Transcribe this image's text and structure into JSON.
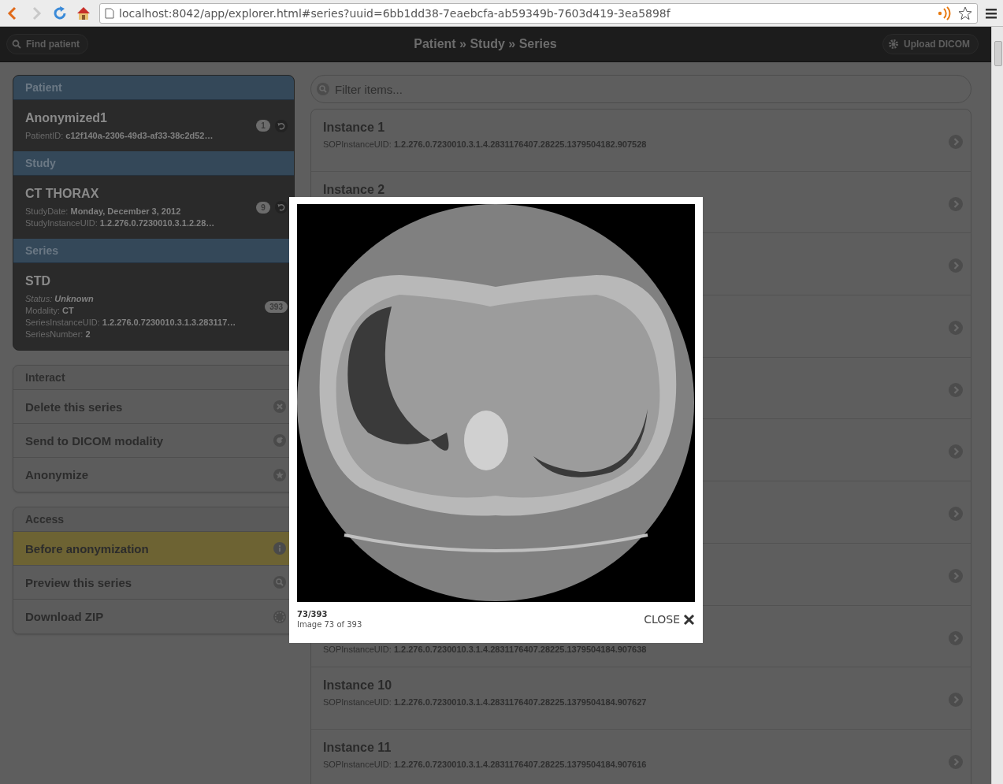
{
  "browser": {
    "url": "localhost:8042/app/explorer.html#series?uuid=6bb1dd38-7eaebcfa-ab59349b-7603d419-3ea5898f"
  },
  "header": {
    "find_button": "Find patient",
    "breadcrumb": "Patient » Study » Series",
    "upload_button": "Upload DICOM"
  },
  "sections": [
    {
      "heading": "Patient",
      "name": "Anonymized1",
      "count": "1",
      "refresh": true,
      "fields": [
        {
          "text": "PatientID: **c12f140a-2306-49d3-af33-38c2d52…**",
          "italic": false
        }
      ]
    },
    {
      "heading": "Study",
      "name": "CT THORAX",
      "count": "9",
      "refresh": true,
      "fields": [
        {
          "text": "StudyDate: **Monday, December 3, 2012**",
          "italic": false
        },
        {
          "text": "StudyInstanceUID: **1.2.276.0.7230010.3.1.2.28…**",
          "italic": false
        }
      ]
    },
    {
      "heading": "Series",
      "name": "STD",
      "count": "393",
      "refresh": false,
      "fields": [
        {
          "text": "Status: **Unknown**",
          "italic": true
        },
        {
          "text": "Modality: **CT**",
          "italic": false
        },
        {
          "text": "SeriesInstanceUID: **1.2.276.0.7230010.3.1.3.283117…**",
          "italic": false
        },
        {
          "text": "SeriesNumber: **2**",
          "italic": false
        }
      ]
    }
  ],
  "interact": {
    "heading": "Interact",
    "items": [
      {
        "label": "Delete this series",
        "kind": "delete",
        "selected": false
      },
      {
        "label": "Send to DICOM modality",
        "kind": "send",
        "selected": false
      },
      {
        "label": "Anonymize",
        "kind": "star",
        "selected": false
      }
    ]
  },
  "access": {
    "heading": "Access",
    "items": [
      {
        "label": "Before anonymization",
        "kind": "info",
        "selected": true
      },
      {
        "label": "Preview this series",
        "kind": "search",
        "selected": false
      },
      {
        "label": "Download ZIP",
        "kind": "download",
        "selected": false
      }
    ]
  },
  "filter": {
    "placeholder": "Filter items..."
  },
  "instances": [
    {
      "kind": "full",
      "title": "Instance 1",
      "uid": "SOPInstanceUID: **1.2.276.0.7230010.3.1.4.2831176407.28225.1379504182.907528**"
    },
    {
      "kind": "title",
      "title": "Instance 2"
    },
    {
      "kind": "covered"
    },
    {
      "kind": "covered"
    },
    {
      "kind": "covered"
    },
    {
      "kind": "covered"
    },
    {
      "kind": "covered"
    },
    {
      "kind": "covered"
    },
    {
      "kind": "uid",
      "uid": "SOPInstanceUID: **1.2.276.0.7230010.3.1.4.2831176407.28225.1379504184.907638**"
    },
    {
      "kind": "full",
      "title": "Instance 10",
      "uid": "SOPInstanceUID: **1.2.276.0.7230010.3.1.4.2831176407.28225.1379504184.907627**"
    },
    {
      "kind": "full",
      "title": "Instance 11",
      "uid": "SOPInstanceUID: **1.2.276.0.7230010.3.1.4.2831176407.28225.1379504184.907616**"
    }
  ],
  "viewer": {
    "counter": "73/393",
    "caption": "Image 73 of 393",
    "close": "CLOSE"
  }
}
